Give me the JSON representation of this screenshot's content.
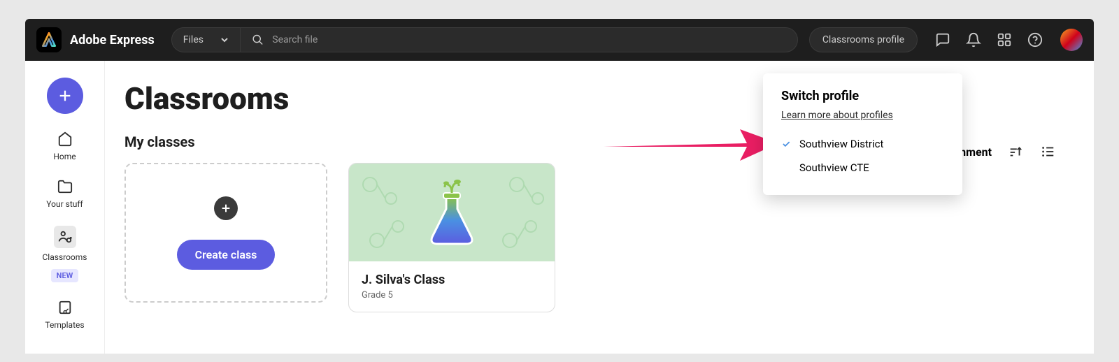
{
  "header": {
    "app_name": "Adobe Express",
    "files_label": "Files",
    "search_placeholder": "Search file",
    "profile_button": "Classrooms profile"
  },
  "sidebar": {
    "items": [
      {
        "label": "Home"
      },
      {
        "label": "Your stuff"
      },
      {
        "label": "Classrooms",
        "badge": "NEW"
      },
      {
        "label": "Templates"
      }
    ]
  },
  "main": {
    "title": "Classrooms",
    "section": "My classes",
    "create_button": "Create class",
    "create_assignment": "Create assignment",
    "classes": [
      {
        "name": "J. Silva's Class",
        "grade": "Grade 5"
      }
    ]
  },
  "popover": {
    "title": "Switch profile",
    "link": "Learn more about profiles",
    "profiles": [
      {
        "label": "Southview District",
        "selected": true
      },
      {
        "label": "Southview CTE",
        "selected": false
      }
    ]
  }
}
